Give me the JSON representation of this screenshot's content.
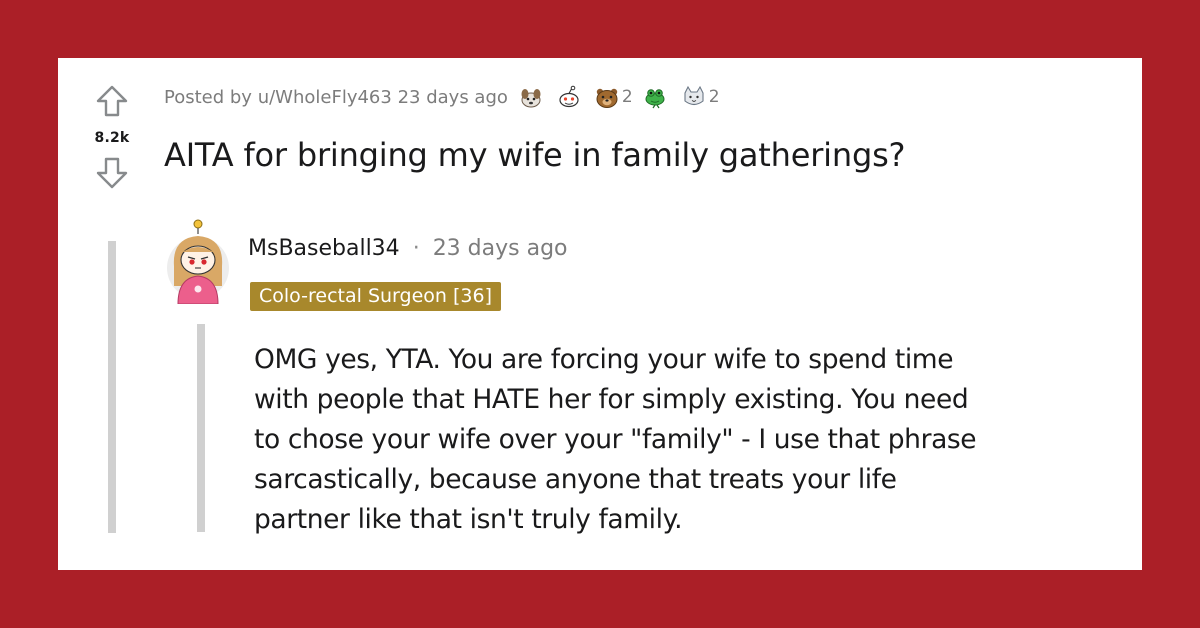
{
  "post": {
    "posted_by_prefix": "Posted by",
    "author": "u/WholeFly463",
    "age": "23 days ago",
    "awards": [
      {
        "icon": "dog-award-icon",
        "count": ""
      },
      {
        "icon": "snoo-award-icon",
        "count": ""
      },
      {
        "icon": "bear-award-icon",
        "count": "2"
      },
      {
        "icon": "frog-award-icon",
        "count": ""
      },
      {
        "icon": "cat-award-icon",
        "count": "2"
      }
    ],
    "score": "8.2k",
    "title": "AITA for bringing my wife in family gatherings?"
  },
  "comment": {
    "author": "MsBaseball34",
    "separator": "·",
    "age": "23 days ago",
    "flair": "Colo-rectal Surgeon [36]",
    "lines": [
      "OMG yes, YTA. You are forcing your wife to spend time",
      "with people that HATE her for simply existing. You need",
      "to chose your wife over your \"family\" - I use that phrase",
      "sarcastically, because anyone that treats your life",
      "partner like that isn't truly family."
    ],
    "flair_color": "#a8882c"
  },
  "colors": {
    "background": "#ab1f27",
    "card": "#ffffff",
    "text": "#1a1a1b",
    "muted": "#7c7c7c"
  }
}
